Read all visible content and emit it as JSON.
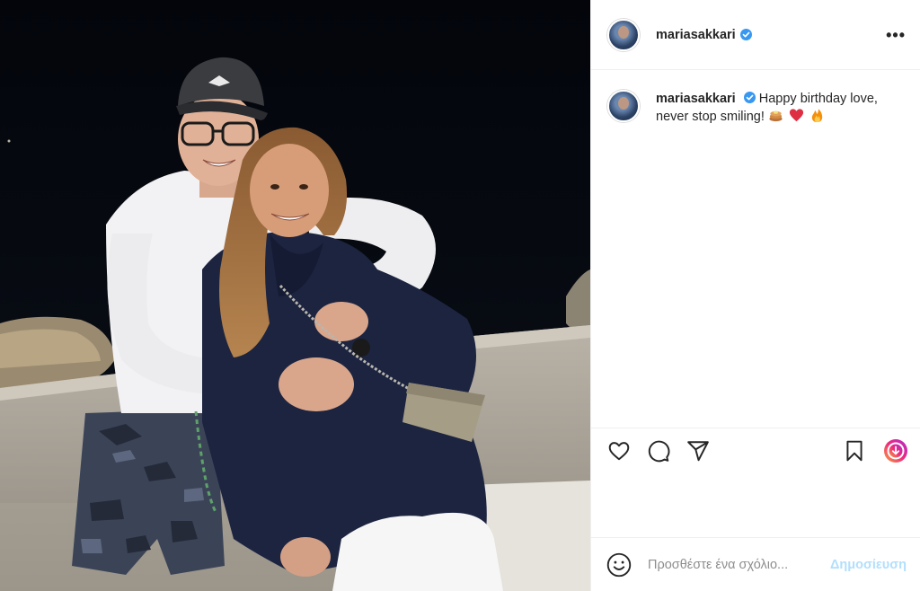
{
  "post": {
    "username": "mariasakkari",
    "verified": true,
    "caption": "Happy birthday love, never stop smiling!",
    "caption_emojis": [
      "pancakes",
      "red-heart",
      "fire"
    ]
  },
  "photo": {
    "cap_logo": "Quiksilver"
  },
  "actions": {
    "icons": [
      "heart-icon",
      "comment-icon",
      "share-icon",
      "bookmark-icon",
      "reel-icon"
    ]
  },
  "comment": {
    "placeholder": "Προσθέστε ένα σχόλιο...",
    "post_label": "Δημοσίευση"
  },
  "colors": {
    "verified": "#3897f0",
    "post_disabled": "#b2dffc",
    "text": "#262626",
    "muted": "#8e8e8e",
    "divider": "#efefef"
  }
}
